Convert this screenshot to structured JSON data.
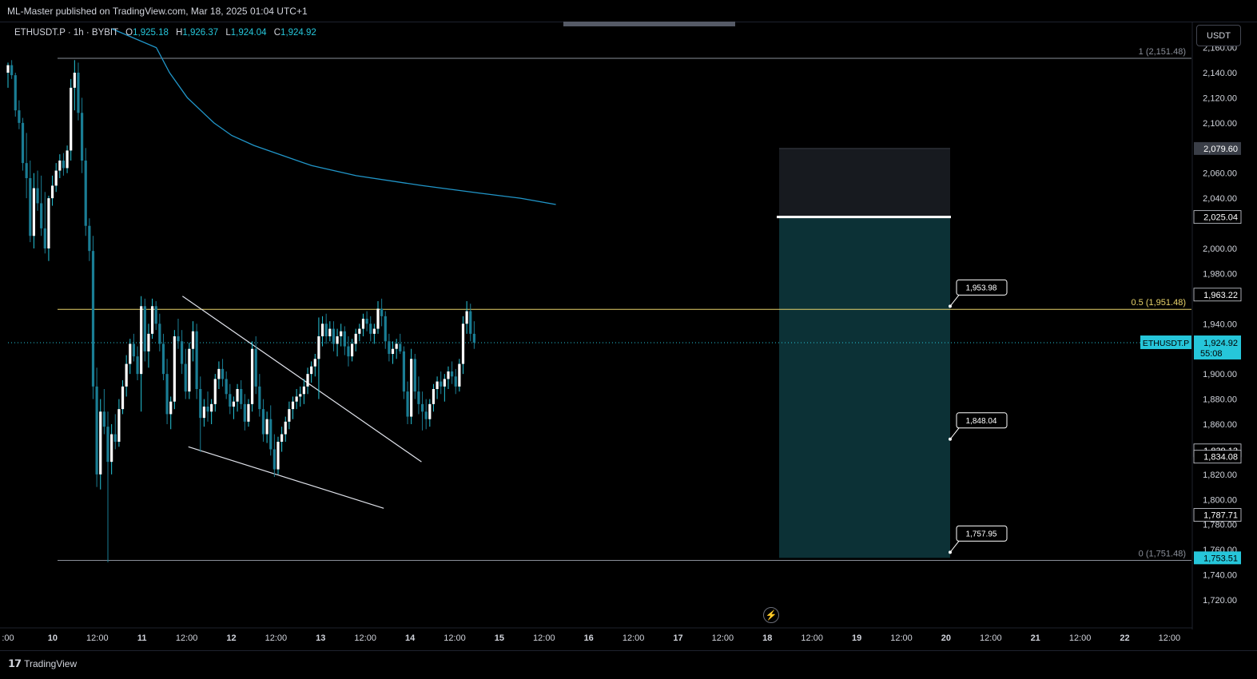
{
  "header": {
    "publish_text": "ML-Master published on TradingView.com, Mar 18, 2025 01:04 UTC+1"
  },
  "legend": {
    "symbol": "ETHUSDT.P · 1h · BYBIT",
    "o_label": "O",
    "o_value": "1,925.18",
    "h_label": "H",
    "h_value": "1,926.37",
    "l_label": "L",
    "l_value": "1,924.04",
    "c_label": "C",
    "c_value": "1,924.92"
  },
  "currency_button": "USDT",
  "footer": {
    "logo_mark": "𝟭𝟳",
    "logo_text": "TradingView"
  },
  "colors": {
    "background": "#000000",
    "up": "#26c6da",
    "down": "#1a7d94",
    "ma": "#2196c9",
    "fib": "#e8d36b",
    "position_target": "#0e3a3f",
    "position_stop": "#1a1d22",
    "price_tag": "#26c6da"
  },
  "chart_data": {
    "type": "candlestick",
    "symbol": "ETHUSDT.P",
    "interval": "1h",
    "exchange": "BYBIT",
    "ylim": [
      1700,
      2170
    ],
    "y_ticks": [
      "2,160.00",
      "2,140.00",
      "2,120.00",
      "2,100.00",
      "2,060.00",
      "2,040.00",
      "2,000.00",
      "1,980.00",
      "1,940.00",
      "1,900.00",
      "1,880.00",
      "1,860.00",
      "1,820.00",
      "1,800.00",
      "1,780.00",
      "1,760.00",
      "1,740.00",
      "1,720.00"
    ],
    "x_ticks": [
      ":00",
      "10",
      "12:00",
      "11",
      "12:00",
      "12",
      "12:00",
      "13",
      "12:00",
      "14",
      "12:00",
      "15",
      "12:00",
      "16",
      "12:00",
      "17",
      "12:00",
      "18",
      "12:00",
      "19",
      "12:00",
      "20",
      "12:00",
      "21",
      "12:00",
      "22",
      "12:00"
    ],
    "price_tags": [
      {
        "text": "2,079.60",
        "value": 2079.6,
        "style": "grey"
      },
      {
        "text": "2,025.04",
        "value": 2025.04,
        "style": "dark"
      },
      {
        "text": "1,963.22",
        "value": 1963.22,
        "style": "dark"
      },
      {
        "text": "1,839.13",
        "value": 1839.13,
        "style": "dark"
      },
      {
        "text": "1,834.08",
        "value": 1834.08,
        "style": "dark"
      },
      {
        "text": "1,787.71",
        "value": 1787.71,
        "style": "dark"
      },
      {
        "text": "1,753.51",
        "value": 1753.51,
        "style": "blue"
      }
    ],
    "last_price": {
      "symbol": "ETHUSDT.P",
      "value_text": "1,924.92",
      "countdown": "55:08",
      "value": 1924.92
    },
    "fib": [
      {
        "label": "1 (2,151.48)",
        "value": 2151.48
      },
      {
        "label": "0.5 (1,951.48)",
        "value": 1951.48
      },
      {
        "label": "0 (1,751.48)",
        "value": 1751.48
      }
    ],
    "callouts": [
      {
        "text": "1,953.98",
        "value": 1953.98
      },
      {
        "text": "1,848.04",
        "value": 1848.04
      },
      {
        "text": "1,757.95",
        "value": 1757.95
      }
    ],
    "position": {
      "entry": 2025.04,
      "stop": 2079.6,
      "target": 1753.51
    },
    "channel_upper": {
      "from": {
        "t": 12.6,
        "p": 1962
      },
      "to": {
        "t": 77.2,
        "p": 1830
      }
    },
    "channel_lower": {
      "from": {
        "t": 14.2,
        "p": 1842
      },
      "to": {
        "t": 67,
        "p": 1793
      }
    },
    "ma_path": [
      [
        0,
        2175
      ],
      [
        10,
        2160
      ],
      [
        13,
        2140
      ],
      [
        17,
        2120
      ],
      [
        23,
        2100
      ],
      [
        27,
        2090
      ],
      [
        32,
        2082
      ],
      [
        45,
        2066
      ],
      [
        55,
        2058
      ],
      [
        70,
        2050
      ],
      [
        83,
        2044
      ],
      [
        92,
        2040
      ],
      [
        100,
        2035
      ]
    ],
    "candles_hint": "approximate hourly OHLC read from chart, x index = hours from left edge (x0=-2)",
    "candles": [
      [
        0,
        2140,
        2148,
        2128,
        2146
      ],
      [
        1,
        2146,
        2150,
        2135,
        2138
      ],
      [
        2,
        2138,
        2140,
        2105,
        2110
      ],
      [
        3,
        2110,
        2118,
        2095,
        2100
      ],
      [
        4,
        2100,
        2104,
        2062,
        2068
      ],
      [
        5,
        2068,
        2092,
        2040,
        2056
      ],
      [
        6,
        2056,
        2070,
        2005,
        2010
      ],
      [
        7,
        2010,
        2060,
        2000,
        2048
      ],
      [
        8,
        2048,
        2062,
        2030,
        2036
      ],
      [
        9,
        2036,
        2058,
        2010,
        2016
      ],
      [
        10,
        2016,
        2045,
        1996,
        2000
      ],
      [
        11,
        2000,
        2042,
        1990,
        2040
      ],
      [
        12,
        2040,
        2058,
        2034,
        2050
      ],
      [
        13,
        2050,
        2068,
        2045,
        2062
      ],
      [
        14,
        2062,
        2075,
        2056,
        2070
      ],
      [
        15,
        2070,
        2076,
        2058,
        2064
      ],
      [
        16,
        2064,
        2082,
        2060,
        2078
      ],
      [
        17,
        2078,
        2135,
        2070,
        2128
      ],
      [
        18,
        2128,
        2150,
        2110,
        2140
      ],
      [
        19,
        2140,
        2148,
        2102,
        2108
      ],
      [
        20,
        2108,
        2120,
        2060,
        2070
      ],
      [
        21,
        2070,
        2080,
        2010,
        2018
      ],
      [
        22,
        2018,
        2024,
        1990,
        1998
      ],
      [
        23,
        1998,
        2010,
        1880,
        1890
      ],
      [
        24,
        1890,
        1905,
        1810,
        1820
      ],
      [
        25,
        1820,
        1880,
        1808,
        1870
      ],
      [
        26,
        1870,
        1888,
        1852,
        1858
      ],
      [
        27,
        1858,
        1870,
        1750,
        1830
      ],
      [
        28,
        1830,
        1860,
        1820,
        1852
      ],
      [
        29,
        1852,
        1868,
        1840,
        1846
      ],
      [
        30,
        1846,
        1880,
        1842,
        1872
      ],
      [
        31,
        1872,
        1895,
        1868,
        1890
      ],
      [
        32,
        1890,
        1915,
        1882,
        1908
      ],
      [
        33,
        1908,
        1928,
        1900,
        1924
      ],
      [
        34,
        1924,
        1932,
        1910,
        1914
      ],
      [
        35,
        1914,
        1922,
        1895,
        1900
      ],
      [
        36,
        1900,
        1962,
        1870,
        1954
      ],
      [
        37,
        1954,
        1960,
        1910,
        1918
      ],
      [
        38,
        1918,
        1940,
        1905,
        1932
      ],
      [
        39,
        1932,
        1960,
        1928,
        1954
      ],
      [
        40,
        1954,
        1958,
        1935,
        1940
      ],
      [
        41,
        1940,
        1948,
        1918,
        1924
      ],
      [
        42,
        1924,
        1932,
        1895,
        1900
      ],
      [
        43,
        1900,
        1912,
        1860,
        1868
      ],
      [
        44,
        1868,
        1882,
        1856,
        1878
      ],
      [
        45,
        1878,
        1935,
        1872,
        1930
      ],
      [
        46,
        1930,
        1944,
        1920,
        1926
      ],
      [
        47,
        1926,
        1935,
        1900,
        1908
      ],
      [
        48,
        1908,
        1920,
        1880,
        1886
      ],
      [
        49,
        1886,
        1925,
        1880,
        1920
      ],
      [
        50,
        1920,
        1942,
        1910,
        1934
      ],
      [
        51,
        1934,
        1940,
        1880,
        1888
      ],
      [
        52,
        1888,
        1898,
        1838,
        1865
      ],
      [
        53,
        1865,
        1880,
        1858,
        1874
      ],
      [
        54,
        1874,
        1886,
        1862,
        1870
      ],
      [
        55,
        1870,
        1880,
        1860,
        1876
      ],
      [
        56,
        1876,
        1900,
        1870,
        1896
      ],
      [
        57,
        1896,
        1910,
        1888,
        1904
      ],
      [
        58,
        1904,
        1912,
        1890,
        1896
      ],
      [
        59,
        1896,
        1902,
        1880,
        1884
      ],
      [
        60,
        1884,
        1892,
        1868,
        1874
      ],
      [
        61,
        1874,
        1882,
        1864,
        1878
      ],
      [
        62,
        1878,
        1892,
        1870,
        1888
      ],
      [
        63,
        1888,
        1895,
        1872,
        1876
      ],
      [
        64,
        1876,
        1884,
        1855,
        1862
      ],
      [
        65,
        1862,
        1880,
        1858,
        1876
      ],
      [
        66,
        1876,
        1926,
        1870,
        1920
      ],
      [
        67,
        1920,
        1930,
        1884,
        1890
      ],
      [
        68,
        1890,
        1900,
        1866,
        1872
      ],
      [
        69,
        1872,
        1880,
        1846,
        1852
      ],
      [
        70,
        1852,
        1870,
        1845,
        1864
      ],
      [
        71,
        1864,
        1875,
        1835,
        1840
      ],
      [
        72,
        1840,
        1852,
        1818,
        1824
      ],
      [
        73,
        1824,
        1850,
        1820,
        1846
      ],
      [
        74,
        1846,
        1858,
        1838,
        1852
      ],
      [
        75,
        1852,
        1866,
        1846,
        1862
      ],
      [
        76,
        1862,
        1878,
        1856,
        1872
      ],
      [
        77,
        1872,
        1882,
        1864,
        1878
      ],
      [
        78,
        1878,
        1888,
        1872,
        1882
      ],
      [
        79,
        1882,
        1890,
        1874,
        1884
      ],
      [
        80,
        1884,
        1896,
        1876,
        1890
      ],
      [
        81,
        1890,
        1905,
        1884,
        1900
      ],
      [
        82,
        1900,
        1910,
        1893,
        1906
      ],
      [
        83,
        1906,
        1916,
        1898,
        1912
      ],
      [
        84,
        1912,
        1945,
        1880,
        1930
      ],
      [
        85,
        1930,
        1946,
        1922,
        1940
      ],
      [
        86,
        1940,
        1948,
        1924,
        1930
      ],
      [
        87,
        1930,
        1942,
        1926,
        1936
      ],
      [
        88,
        1936,
        1942,
        1918,
        1924
      ],
      [
        89,
        1924,
        1936,
        1914,
        1930
      ],
      [
        90,
        1930,
        1940,
        1922,
        1934
      ],
      [
        91,
        1934,
        1938,
        1915,
        1922
      ],
      [
        92,
        1922,
        1930,
        1906,
        1914
      ],
      [
        93,
        1914,
        1928,
        1910,
        1924
      ],
      [
        94,
        1924,
        1936,
        1918,
        1932
      ],
      [
        95,
        1932,
        1940,
        1926,
        1936
      ],
      [
        96,
        1936,
        1948,
        1930,
        1944
      ],
      [
        97,
        1944,
        1950,
        1934,
        1940
      ],
      [
        98,
        1940,
        1946,
        1926,
        1932
      ],
      [
        99,
        1932,
        1940,
        1924,
        1936
      ],
      [
        100,
        1936,
        1958,
        1932,
        1952
      ],
      [
        101,
        1952,
        1960,
        1938,
        1946
      ],
      [
        102,
        1946,
        1950,
        1920,
        1926
      ],
      [
        103,
        1926,
        1932,
        1910,
        1916
      ],
      [
        104,
        1916,
        1926,
        1908,
        1920
      ],
      [
        105,
        1920,
        1928,
        1912,
        1924
      ],
      [
        106,
        1924,
        1932,
        1916,
        1918
      ],
      [
        107,
        1918,
        1922,
        1880,
        1886
      ],
      [
        108,
        1886,
        1894,
        1860,
        1866
      ],
      [
        109,
        1866,
        1920,
        1860,
        1912
      ],
      [
        110,
        1912,
        1916,
        1880,
        1886
      ],
      [
        111,
        1886,
        1898,
        1868,
        1876
      ],
      [
        112,
        1876,
        1886,
        1855,
        1870
      ],
      [
        113,
        1870,
        1880,
        1856,
        1864
      ],
      [
        114,
        1864,
        1880,
        1858,
        1876
      ],
      [
        115,
        1876,
        1892,
        1870,
        1888
      ],
      [
        116,
        1888,
        1898,
        1880,
        1894
      ],
      [
        117,
        1894,
        1902,
        1884,
        1890
      ],
      [
        118,
        1890,
        1900,
        1878,
        1896
      ],
      [
        119,
        1896,
        1906,
        1888,
        1902
      ],
      [
        120,
        1902,
        1910,
        1892,
        1898
      ],
      [
        121,
        1898,
        1904,
        1884,
        1890
      ],
      [
        122,
        1890,
        1912,
        1886,
        1908
      ],
      [
        123,
        1908,
        1946,
        1900,
        1940
      ],
      [
        124,
        1940,
        1958,
        1932,
        1950
      ],
      [
        125,
        1950,
        1956,
        1926,
        1932
      ],
      [
        126,
        1932,
        1942,
        1920,
        1925
      ]
    ]
  }
}
